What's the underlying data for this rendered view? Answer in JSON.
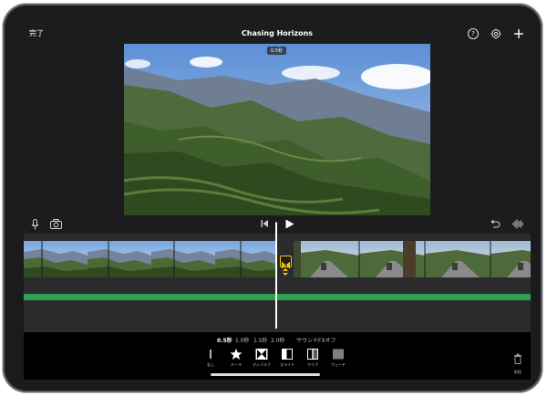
{
  "topbar": {
    "done_label": "完了",
    "title": "Chasing Horizons",
    "help_symbol": "?"
  },
  "viewer": {
    "duration_badge": "0.5秒"
  },
  "transition_panel": {
    "durations": [
      {
        "label": "0.5秒",
        "selected": true
      },
      {
        "label": "1.0秒",
        "selected": false
      },
      {
        "label": "1.5秒",
        "selected": false
      },
      {
        "label": "2.0秒",
        "selected": false
      }
    ],
    "sound_fx_label": "サウンドFXオフ",
    "options": [
      {
        "label": "なし",
        "icon": "none-icon"
      },
      {
        "label": "テーマ",
        "icon": "star-icon"
      },
      {
        "label": "ディゾルブ",
        "icon": "dissolve-icon"
      },
      {
        "label": "スライド",
        "icon": "slide-icon"
      },
      {
        "label": "ワイプ",
        "icon": "wipe-icon"
      },
      {
        "label": "フェード",
        "icon": "fade-icon"
      }
    ],
    "delete_label": "削除"
  },
  "colors": {
    "accent_yellow": "#f7c500",
    "audio_green": "#2ca24e",
    "background": "#1c1c1e"
  }
}
